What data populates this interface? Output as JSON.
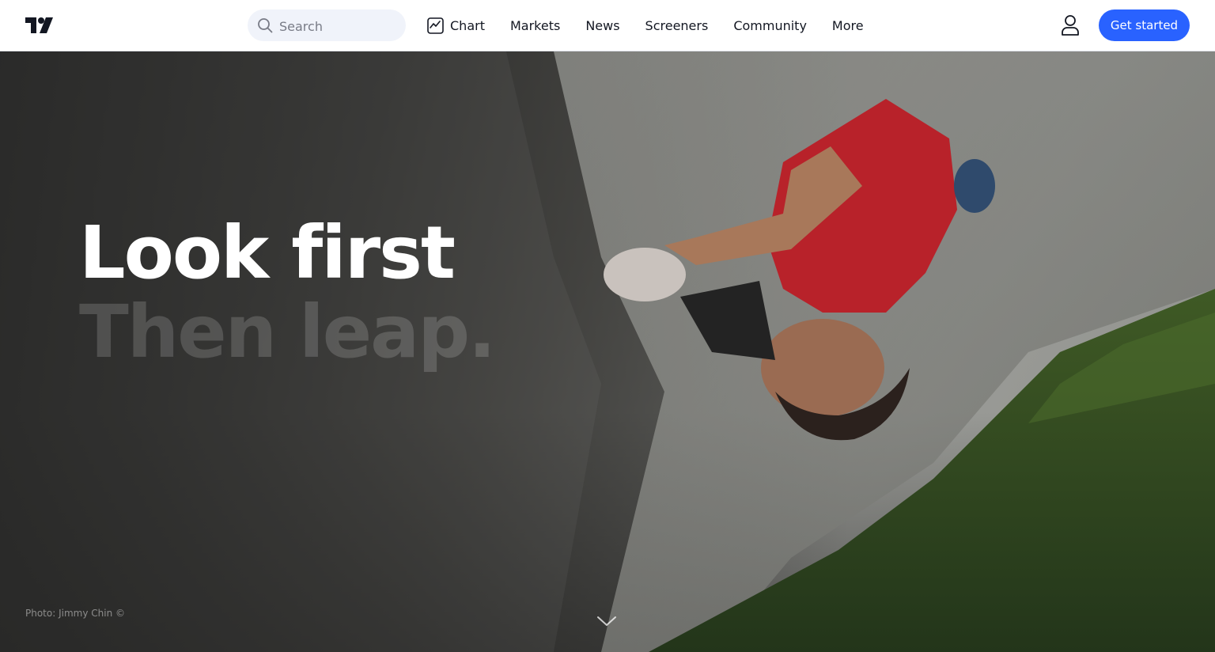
{
  "brand": {
    "logo_icon": "tradingview-logo-icon"
  },
  "search": {
    "placeholder": "Search",
    "icon": "search-icon"
  },
  "nav": {
    "items": [
      {
        "label": "Chart",
        "icon": "chart-icon"
      },
      {
        "label": "Markets"
      },
      {
        "label": "News"
      },
      {
        "label": "Screeners"
      },
      {
        "label": "Community"
      },
      {
        "label": "More"
      }
    ]
  },
  "account": {
    "icon": "user-icon"
  },
  "cta": {
    "label": "Get started",
    "color": "#2962ff"
  },
  "hero": {
    "headline_line1": "Look first",
    "headline_line2": "Then leap.",
    "photo_credit": "Photo: Jimmy Chin ©",
    "scroll_icon": "chevron-down-icon"
  }
}
